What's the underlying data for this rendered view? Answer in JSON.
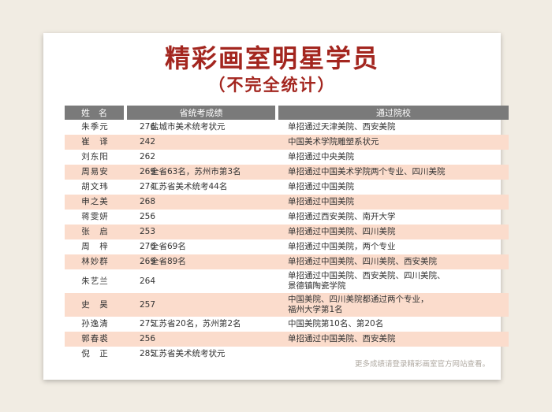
{
  "title": "精彩画室明星学员",
  "subtitle": "（不完全统计）",
  "headers": {
    "name": "姓　名",
    "exam": "省统考成绩",
    "school": "通过院校"
  },
  "rows": [
    {
      "name": "朱季元",
      "score": "276",
      "note": "盐城市美术统考状元",
      "school": "单招通过天津美院、西安美院"
    },
    {
      "name": "崔　译",
      "score": "242",
      "note": "",
      "school": "中国美术学院雕塑系状元"
    },
    {
      "name": "刘东阳",
      "score": "262",
      "note": "",
      "school": "单招通过中央美院"
    },
    {
      "name": "周易安",
      "score": "269",
      "note": "全省63名，苏州市第3名",
      "school": "单招通过中国美术学院两个专业、四川美院"
    },
    {
      "name": "胡文玮",
      "score": "274",
      "note": "江苏省美术统考44名",
      "school": "单招通过中国美院"
    },
    {
      "name": "申之美",
      "score": "268",
      "note": "",
      "school": "单招通过中国美院"
    },
    {
      "name": "蒋雯妍",
      "score": "256",
      "note": "",
      "school": "单招通过西安美院、南开大学"
    },
    {
      "name": "张　启",
      "score": "253",
      "note": "",
      "school": "单招通过中国美院、四川美院"
    },
    {
      "name": "周　梓",
      "score": "270",
      "note": "全省69名",
      "school": "单招通过中国美院，两个专业"
    },
    {
      "name": "林妙群",
      "score": "269",
      "note": "全省89名",
      "school": "单招通过中国美院、四川美院、西安美院"
    },
    {
      "name": "朱艺兰",
      "score": "264",
      "note": "",
      "school": "单招通过中国美院、西安美院、四川美院、",
      "school2": "景德镇陶瓷学院"
    },
    {
      "name": "史　昊",
      "score": "257",
      "note": "",
      "school": "中国美院、四川美院都通过两个专业，",
      "school2": "福州大学第1名"
    },
    {
      "name": "孙逸清",
      "score": "275",
      "note": "江苏省20名，苏州第2名",
      "school": "中国美院第10名、第20名"
    },
    {
      "name": "郭春裘",
      "score": "256",
      "note": "",
      "school": "单招通过中国美院、西安美院"
    },
    {
      "name": "倪　正",
      "score": "285",
      "note": "江苏省美术统考状元",
      "school": ""
    }
  ],
  "footer": "更多成绩请登录精彩画室官方网站查看。",
  "colors": {
    "accent": "#a3261f",
    "header_bg": "#7a7a7a",
    "alt_row": "#fbdccc",
    "page_bg": "#f1ece3"
  }
}
